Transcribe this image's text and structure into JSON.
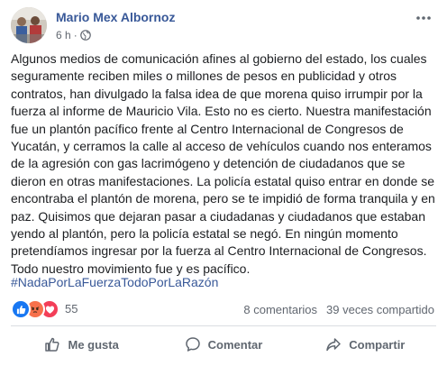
{
  "post": {
    "author": "Mario Mex Albornoz",
    "time": "6 h",
    "separator": "·",
    "text": "Algunos medios de comunicación afines al gobierno del estado, los cuales seguramente reciben miles o millones de pesos en publicidad y otros contratos, han divulgado la falsa idea de que morena quiso irrumpir por la fuerza al informe de Mauricio Vila. Esto no es cierto. Nuestra manifestación fue un plantón pacífico frente al Centro Internacional de Congresos de Yucatán, y cerramos la calle al acceso de vehículos cuando nos enteramos de la agresión con gas lacrimógeno y detención de ciudadanos que se dieron en otras manifestaciones. La policía estatal quiso entrar en donde se encontraba el plantón de morena, pero se te impidió de forma tranquila y en paz. Quisimos que dejaran pasar a ciudadanas y ciudadanos que estaban yendo al plantón, pero la policía estatal se negó. En ningún momento pretendíamos ingresar por la fuerza al Centro Internacional de Congresos. Todo nuestro movimiento fue y es pacífico.",
    "hashtag": "#NadaPorLaFuerzaTodoPorLaRazón",
    "audience_icon": "globe-icon",
    "more_icon": "more-options-icon"
  },
  "reactions": {
    "types": [
      "like",
      "angry",
      "love"
    ],
    "count": "55"
  },
  "stats": {
    "comments": "8 comentarios",
    "shares": "39 veces compartido"
  },
  "actions": {
    "like": "Me gusta",
    "comment": "Comentar",
    "share": "Compartir"
  },
  "colors": {
    "link": "#385898",
    "meta": "#616770",
    "text": "#1c1e21",
    "like": "#1877f2",
    "angry": "#f7714c",
    "love": "#f33e58"
  }
}
